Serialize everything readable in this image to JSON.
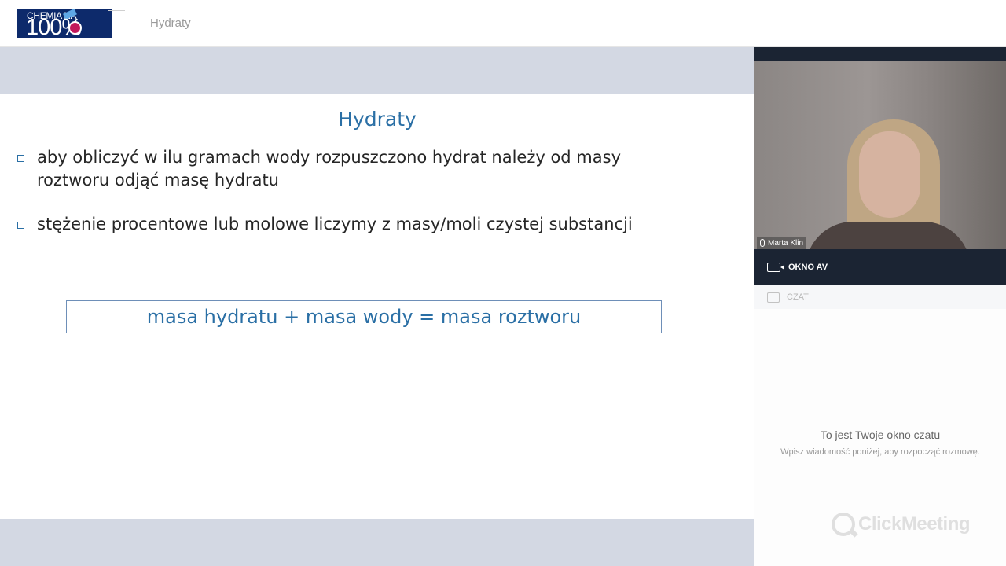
{
  "header": {
    "logo_top": "CHEMIA NA",
    "logo_bottom": "100%",
    "title": "Hydraty"
  },
  "slide": {
    "title": "Hydraty",
    "bullets": [
      "aby obliczyć w ilu gramach wody rozpuszczono hydrat należy od masy roztworu odjąć masę hydratu",
      "stężenie procentowe lub molowe liczymy z masy/moli czystej substancji"
    ],
    "formula": "masa hydratu + masa wody = masa roztworu"
  },
  "video": {
    "speaker_name": "Marta Klin",
    "av_label": "OKNO AV"
  },
  "chat": {
    "tab_label": "CZAT",
    "title": "To jest Twoje okno czatu",
    "subtitle": "Wpisz wiadomość poniżej, aby rozpocząć rozmowę.",
    "brand": "ClickMeeting"
  },
  "colors": {
    "accent": "#2a6fa5",
    "slide_bg": "#d3d8e3",
    "panel_dark": "#1b2433",
    "logo_bg": "#0d2a6b"
  },
  "icons": {
    "bullet": "square-bullet-icon",
    "mic": "microphone-icon",
    "camera": "camera-icon",
    "chat": "chat-icon",
    "brand": "clickmeeting-logo-icon"
  }
}
